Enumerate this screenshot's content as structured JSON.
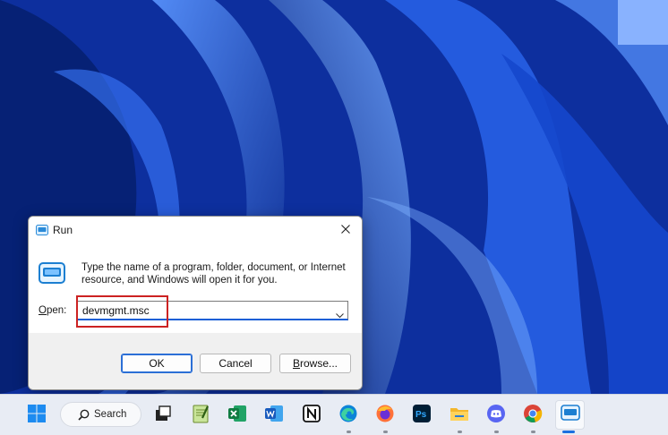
{
  "dialog": {
    "title": "Run",
    "description": "Type the name of a program, folder, document, or Internet resource, and Windows will open it for you.",
    "open_label_prefix": "",
    "open_label_accel": "O",
    "open_label_rest": "pen:",
    "open_value": "devmgmt.msc",
    "ok_label": "OK",
    "cancel_label": "Cancel",
    "browse_accel": "B",
    "browse_rest": "rowse..."
  },
  "taskbar": {
    "search_label": "Search",
    "items": [
      "windows-start",
      "search",
      "task-view",
      "notepad-plus",
      "excel",
      "word",
      "notion",
      "edge",
      "firefox",
      "photoshop",
      "file-explorer",
      "discord",
      "chrome",
      "run"
    ]
  },
  "colors": {
    "accent": "#1a6fe0",
    "highlight": "#cc2222",
    "taskbar": "#e8ecf4"
  }
}
